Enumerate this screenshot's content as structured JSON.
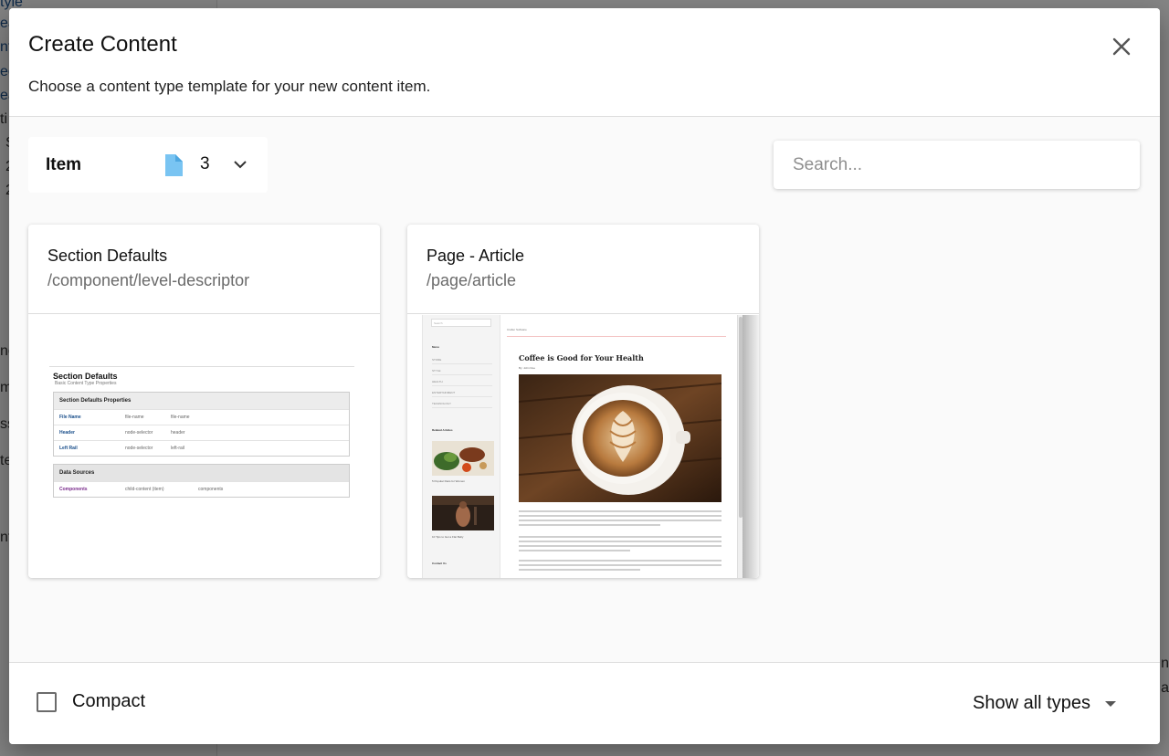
{
  "background": {
    "left_fragments": [
      "tyle",
      "ea",
      "nt",
      "ec",
      "ea",
      "ti",
      "S",
      "2",
      "2",
      "ne",
      "m",
      "ss",
      "te",
      "nf"
    ],
    "right_fragments": [
      "n",
      "a"
    ]
  },
  "dialog": {
    "title": "Create Content",
    "subtitle": "Choose a content type template for your new content item.",
    "close_icon": "close-icon"
  },
  "toolbar": {
    "type_label": "Item",
    "type_icon": "file-icon",
    "type_count": "3",
    "search_placeholder": "Search..."
  },
  "cards": [
    {
      "name": "Section Defaults",
      "path": "/component/level-descriptor",
      "preview": {
        "title": "Section Defaults",
        "subtitle": "Basic Content Type Properties",
        "panel1_title": "Section Defaults Properties",
        "panel1_rows": [
          [
            "File Name",
            "file-name",
            "file-name"
          ],
          [
            "Header",
            "node-selector",
            "header"
          ],
          [
            "Left Rail",
            "node-selector",
            "left-rail"
          ]
        ],
        "panel2_title": "Data Sources",
        "panel2_rows": [
          [
            "Components",
            "child-content (item)",
            "components"
          ]
        ]
      }
    },
    {
      "name": "Page - Article",
      "path": "/page/article",
      "preview": {
        "search": "Search",
        "menu": "Menu",
        "nav": [
          "STORE",
          "STYLE",
          "HEALTH",
          "ENTERTAINMENT",
          "TECHNOLOGY"
        ],
        "related": "Related Articles",
        "caption1": "5 Popular Diets for Women",
        "caption2": "10 Tips to Get a Flat Belly",
        "contact": "Contact Us",
        "site": "Crafter Software",
        "headline": "Coffee is Good for Your Health",
        "byline": "By: John Doe"
      }
    }
  ],
  "footer": {
    "compact_label": "Compact",
    "compact_checked": false,
    "show_types_label": "Show all types"
  }
}
